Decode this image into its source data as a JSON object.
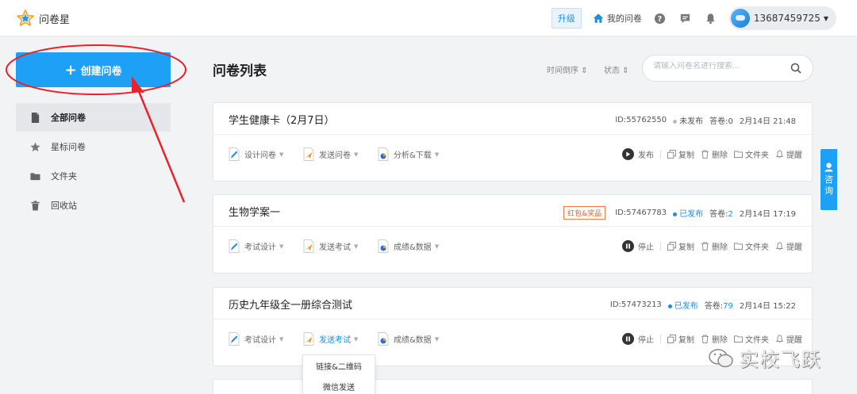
{
  "app": {
    "name": "问卷星"
  },
  "header": {
    "upgrade": "升级",
    "my_surveys": "我的问卷",
    "user_phone": "13687459725"
  },
  "sidebar": {
    "create_label": "创建问卷",
    "items": [
      {
        "label": "全部问卷",
        "icon": "document-icon",
        "active": true
      },
      {
        "label": "星标问卷",
        "icon": "star-icon",
        "active": false
      },
      {
        "label": "文件夹",
        "icon": "folder-icon",
        "active": false
      },
      {
        "label": "回收站",
        "icon": "trash-icon",
        "active": false
      }
    ]
  },
  "main": {
    "title": "问卷列表",
    "sort_time": "时间倒序",
    "sort_status": "状态",
    "search_placeholder": "请输入问卷名进行搜索...",
    "cards": [
      {
        "title": "学生健康卡（2月7日）",
        "tag": "",
        "id": "ID:55762550",
        "status": "未发布",
        "answers_label": "答卷:",
        "answers": "0",
        "date": "2月14日 21:48",
        "actions": [
          "设计问卷",
          "发送问卷",
          "分析&下载"
        ],
        "primary_op": "发布",
        "ops": [
          "复制",
          "删除",
          "文件夹",
          "提醒"
        ]
      },
      {
        "title": "生物学案一",
        "tag": "红包&奖品",
        "id": "ID:57467783",
        "status": "已发布",
        "answers_label": "答卷:",
        "answers": "2",
        "date": "2月14日 17:19",
        "actions": [
          "考试设计",
          "发送考试",
          "成绩&数据"
        ],
        "primary_op": "停止",
        "ops": [
          "复制",
          "删除",
          "文件夹",
          "提醒"
        ]
      },
      {
        "title": "历史九年级全一册综合测试",
        "tag": "",
        "id": "ID:57473213",
        "status": "已发布",
        "answers_label": "答卷:",
        "answers": "79",
        "date": "2月14日 15:22",
        "actions": [
          "考试设计",
          "发送考试",
          "成绩&数据"
        ],
        "primary_op": "停止",
        "ops": [
          "复制",
          "删除",
          "文件夹",
          "提醒"
        ]
      }
    ],
    "dropdown": [
      "链接&二维码",
      "微信发送"
    ]
  },
  "consult": [
    "咨",
    "询"
  ],
  "watermark": "实校飞跃",
  "colors": {
    "accent": "#1ea0f7",
    "annotation": "#e8232b",
    "tag": "#f25a1f"
  }
}
